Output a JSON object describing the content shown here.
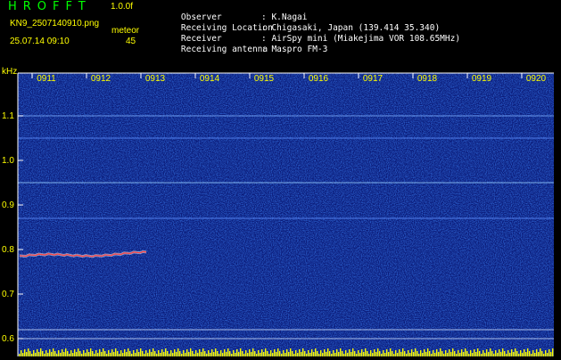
{
  "header": {
    "app_title": "HROFFT",
    "version": "1.0.0f",
    "filename": "KN9_2507140910.png",
    "meteor_label": "meteor",
    "datetime": "25.07.14 09:10",
    "meteor_count": "45"
  },
  "info": [
    {
      "label": "Observer",
      "value": ": K.Nagai"
    },
    {
      "label": "Receiving Location",
      "value": ": Chigasaki, Japan (139.414 35.340)"
    },
    {
      "label": "Receiver",
      "value": ": AirSpy mini (Miakejima VOR 108.65MHz)"
    },
    {
      "label": "Receiving antenna",
      "value": ": Maspro FM-3"
    }
  ],
  "plot": {
    "y_unit": "kHz",
    "y_ticks": [
      "1.1",
      "1.0",
      "0.9",
      "0.8",
      "0.7",
      "0.6"
    ],
    "x_ticks": [
      "0911",
      "0912",
      "0913",
      "0914",
      "0915",
      "0916",
      "0917",
      "0918",
      "0919",
      "0920"
    ],
    "colors": {
      "background": "#0a1a78",
      "axis": "#ffffff",
      "tick_label": "#ffff00",
      "signal": "#ff4040",
      "noise_floor": "#ffff00"
    }
  }
}
